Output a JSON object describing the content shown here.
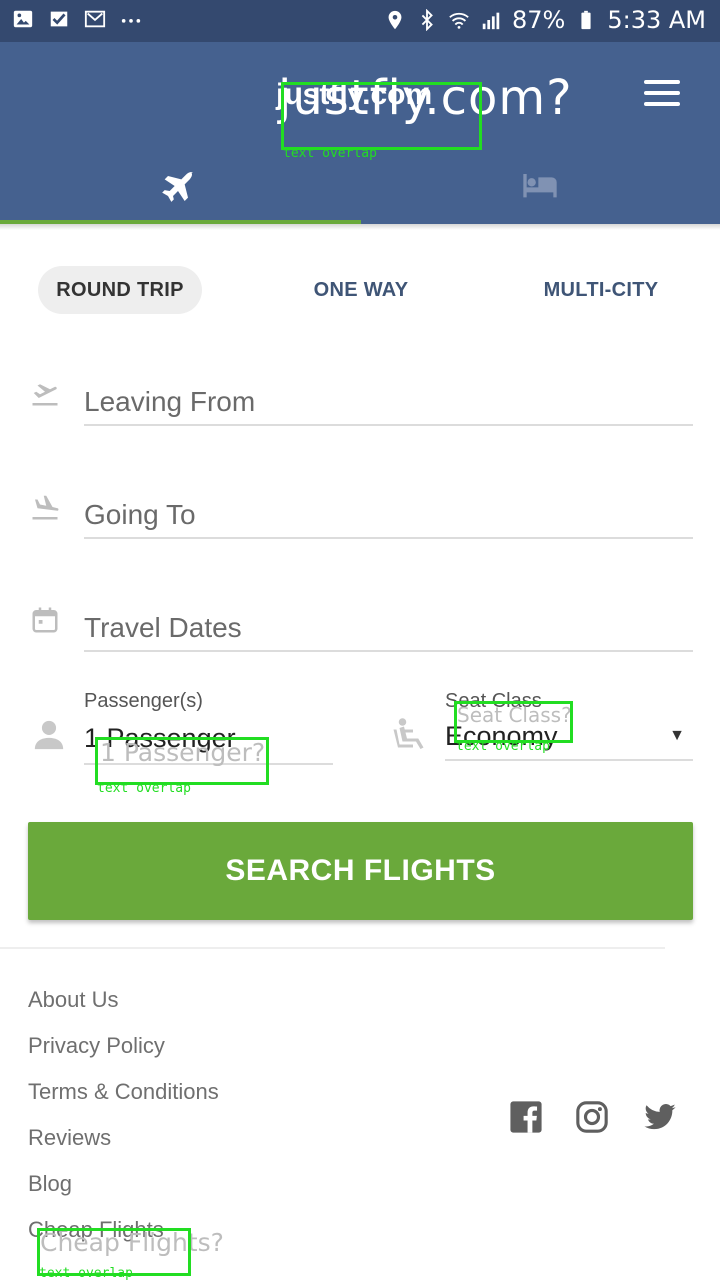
{
  "status_bar": {
    "battery": "87%",
    "time": "5:33 AM",
    "icons": [
      "image-icon",
      "check-icon",
      "mail-icon",
      "more-icon",
      "location-icon",
      "bluetooth-icon",
      "wifi-icon",
      "signal-icon",
      "battery-icon"
    ]
  },
  "header": {
    "logo_large": "justfly.com?",
    "logo_small": "justfly.com",
    "overlay_label": "text overlap",
    "tabs": [
      {
        "name": "flights",
        "icon": "airplane-icon",
        "active": true
      },
      {
        "name": "hotels",
        "icon": "bed-icon",
        "active": false
      }
    ],
    "accent_color": "#6aa93b",
    "bar_color": "#45618f"
  },
  "trip_types": {
    "round_trip": "ROUND TRIP",
    "one_way": "ONE WAY",
    "multi_city": "MULTI-CITY"
  },
  "form": {
    "leaving_from": {
      "placeholder": "Leaving From",
      "icon": "takeoff-icon"
    },
    "going_to": {
      "placeholder": "Going To",
      "icon": "landing-icon"
    },
    "travel_dates": {
      "placeholder": "Travel Dates",
      "icon": "calendar-icon"
    },
    "passengers": {
      "label": "Passenger(s)",
      "value": "1 Passenger",
      "ghost": "1 Passenger?",
      "overlay_label": "text overlap",
      "icon": "person-icon"
    },
    "seat_class": {
      "label": "Seat Class",
      "value": "Economy",
      "ghost": "Seat Class?",
      "overlay_label": "text overlap",
      "icon": "seat-icon"
    }
  },
  "search_button": "SEARCH FLIGHTS",
  "footer": {
    "links": [
      "About Us",
      "Privacy Policy",
      "Terms & Conditions",
      "Reviews",
      "Blog",
      "Cheap Flights"
    ],
    "ghost": "Cheap Flights?",
    "overlay_label": "text overlap",
    "social": [
      "facebook-icon",
      "instagram-icon",
      "twitter-icon"
    ]
  }
}
